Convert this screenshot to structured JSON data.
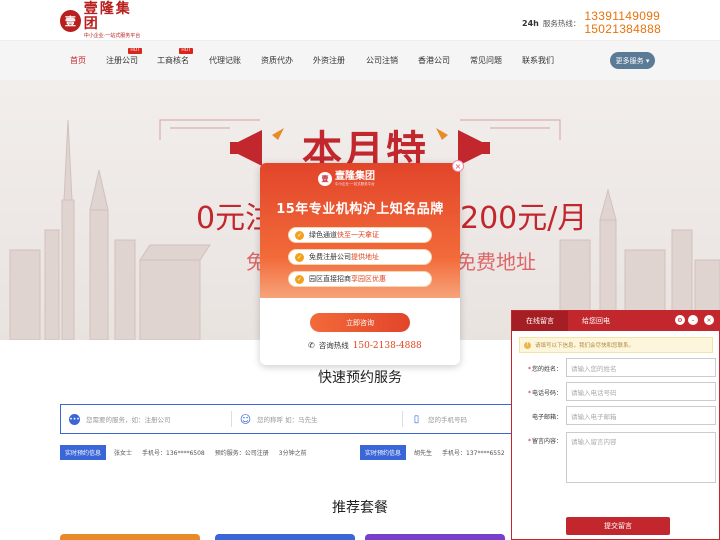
{
  "header": {
    "logo_seal": "壹",
    "logo_name": "壹隆集团",
    "logo_slogan": "中小企业·一站式服务平台",
    "hotline_icon": "24h",
    "hotline_label": "服务热线：",
    "hotline_1": "13391149099",
    "hotline_2": "15021384888"
  },
  "nav": {
    "items": [
      {
        "label": "首页",
        "active": true
      },
      {
        "label": "注册公司",
        "hot": "HOT"
      },
      {
        "label": "工商核名",
        "hot": "HOT"
      },
      {
        "label": "代理记账"
      },
      {
        "label": "资质代办"
      },
      {
        "label": "外资注册"
      },
      {
        "label": "公司注销"
      },
      {
        "label": "香港公司"
      },
      {
        "label": "常见问题"
      },
      {
        "label": "联系我们"
      }
    ],
    "more_label": "更多服务 ▾"
  },
  "banner": {
    "title": "本月特惠",
    "price_left": "0元注",
    "price_right": "200元/月",
    "sub_left": "免",
    "sub_right": "免费地址"
  },
  "modal": {
    "logo_seal": "壹",
    "logo_name": "壹隆集团",
    "logo_slogan": "中小企业·一站式服务平台",
    "headline": "15年专业机构沪上知名品牌",
    "features": [
      {
        "text": "绿色通道",
        "hl": "快至一天拿证"
      },
      {
        "text": "免费注册公司",
        "hl": "提供地址"
      },
      {
        "text": "园区直接招商",
        "hl": "享园区优惠"
      }
    ],
    "close": "×",
    "button": "立即咨询",
    "hotline_label": "咨询热线",
    "hotline_number": "150-2138-4888"
  },
  "section": {
    "title": "快速预约服务",
    "recommend_title": "推荐套餐"
  },
  "search": {
    "service_placeholder": "您需要的服务，如：注册公司",
    "name_placeholder": "您的称呼 如：马先生",
    "phone_placeholder": "您的手机号码"
  },
  "reservations": {
    "tag": "实时预约信息",
    "left": {
      "name": "张女士",
      "phone": "手机号：136****6508",
      "service": "预约服务：公司注册",
      "time": "3分钟之前"
    },
    "right": {
      "name": "胡先生",
      "phone": "手机号：137****6552"
    }
  },
  "message": {
    "tab_active": "在线留言",
    "tab_other": "给您回电",
    "notice": "请填写以下信息，我们会尽快和您联系。",
    "fields": [
      {
        "label": "您的姓名：",
        "required": true,
        "placeholder": "请输入您的姓名"
      },
      {
        "label": "电话号码：",
        "required": true,
        "placeholder": "请输入电话号码"
      },
      {
        "label": "电子邮箱：",
        "required": false,
        "placeholder": "请输入电子邮箱"
      }
    ],
    "content_label": "留言内容：",
    "content_placeholder": "请输入留言内容",
    "submit": "提交留言"
  },
  "colors": {
    "brand_red": "#c1272d",
    "hotline_orange": "#e8730c",
    "accent_blue": "#3b66d8",
    "modal_orange": "#f26a3a"
  }
}
